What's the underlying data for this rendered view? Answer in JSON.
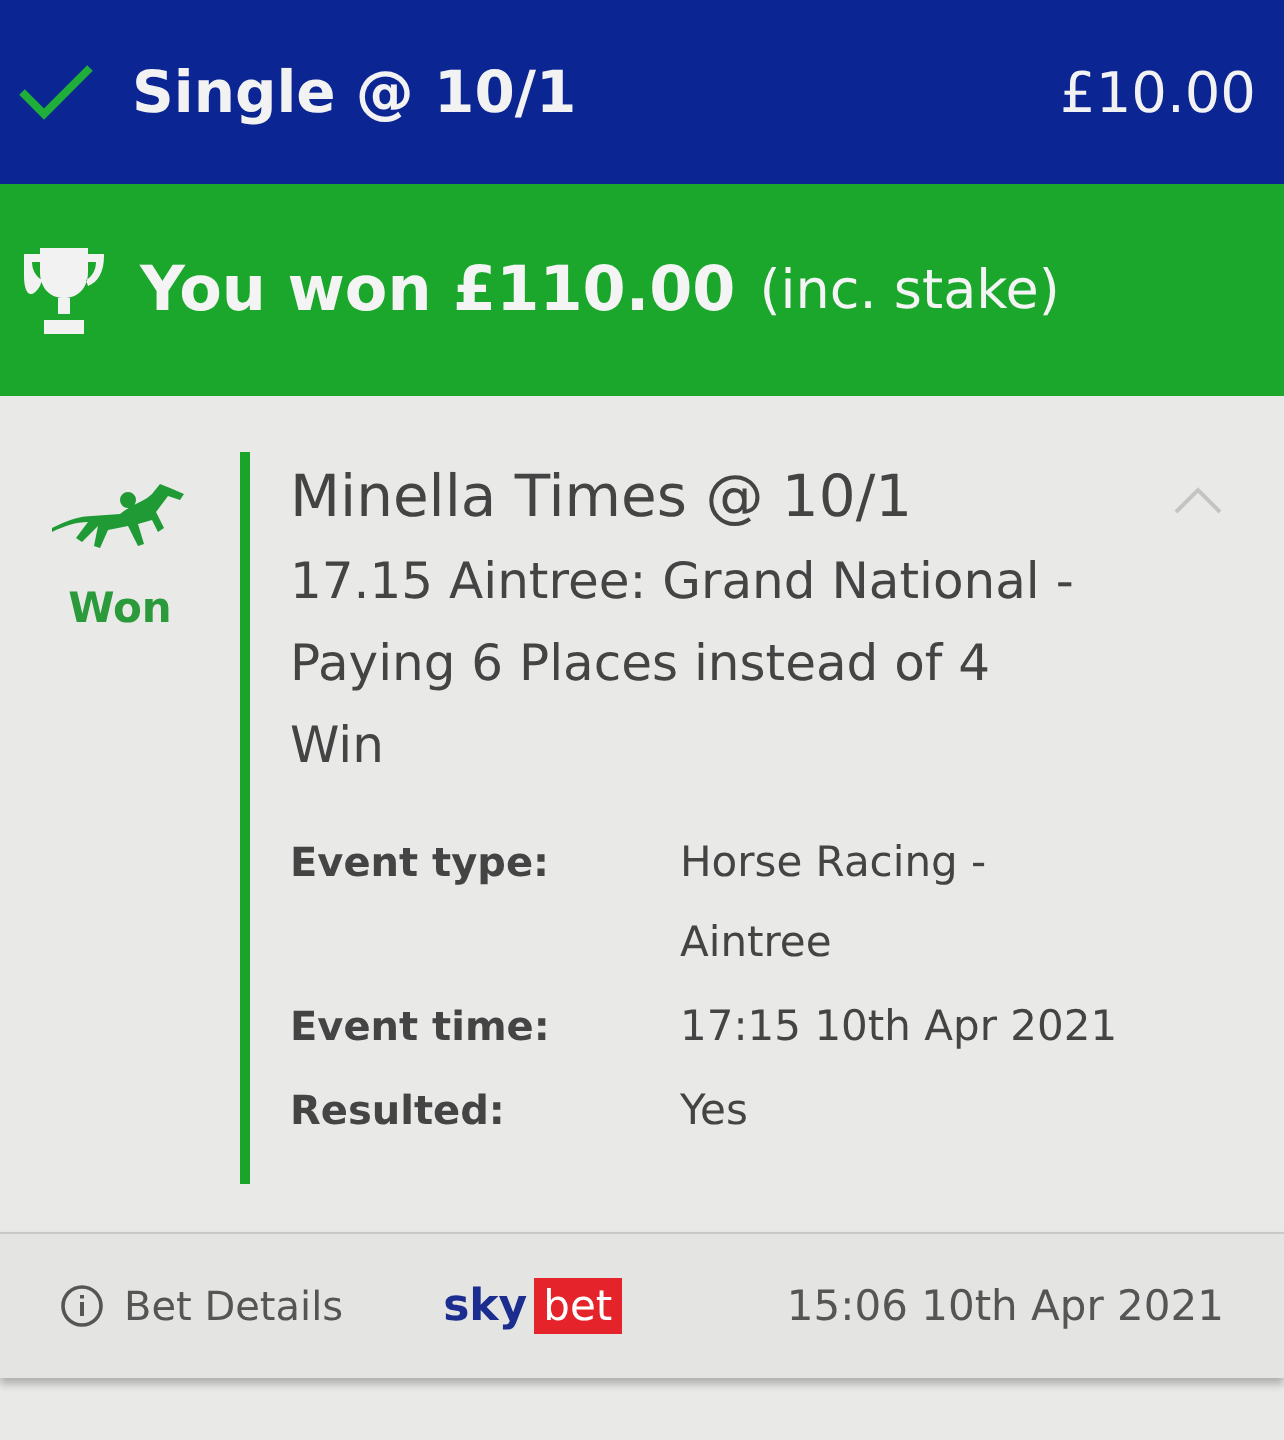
{
  "header": {
    "title": "Single @ 10/1",
    "stake": "£10.00",
    "settled": true
  },
  "banner": {
    "amount_text": "You won £110.00",
    "note": "(inc. stake)"
  },
  "selection": {
    "status": "Won",
    "name": "Minella Times @ 10/1",
    "expanded": true,
    "event": "17.15 Aintree: Grand National - Paying 6 Places instead of 4",
    "market": "Win",
    "details": [
      {
        "label": "Event type:",
        "value": "Horse Racing - Aintree"
      },
      {
        "label": "Event time:",
        "value": "17:15 10th Apr 2021"
      },
      {
        "label": "Resulted:",
        "value": "Yes"
      }
    ]
  },
  "footer": {
    "link": "Bet Details",
    "logo_first": "sky",
    "logo_second": "bet",
    "placed": "15:06 10th Apr 2021"
  }
}
